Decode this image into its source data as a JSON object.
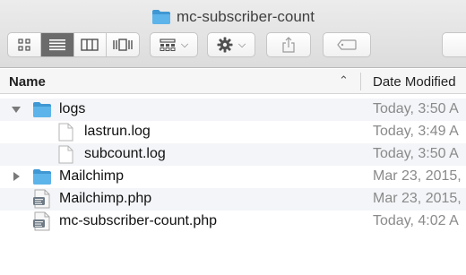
{
  "window": {
    "title": "mc-subscriber-count"
  },
  "toolbar": {
    "view_modes": [
      "icon-view",
      "list-view",
      "column-view",
      "cover-flow-view"
    ],
    "active_view": "list-view",
    "arrange_icon": "arrange-icon",
    "action_icon": "gear-icon",
    "share_icon": "share-icon",
    "tag_icon": "tag-icon"
  },
  "columns": {
    "name": "Name",
    "date_modified": "Date Modified"
  },
  "files": [
    {
      "name": "logs",
      "date": "Today, 3:50 A",
      "type": "folder",
      "expanded": true,
      "level": 0
    },
    {
      "name": "lastrun.log",
      "date": "Today, 3:49 A",
      "type": "document",
      "level": 1
    },
    {
      "name": "subcount.log",
      "date": "Today, 3:50 A",
      "type": "document",
      "level": 1
    },
    {
      "name": "Mailchimp",
      "date": "Mar 23, 2015,",
      "type": "folder",
      "expanded": false,
      "level": 0
    },
    {
      "name": "Mailchimp.php",
      "date": "Mar 23, 2015,",
      "type": "php",
      "level": 0
    },
    {
      "name": "mc-subscriber-count.php",
      "date": "Today, 4:02 A",
      "type": "php",
      "level": 0
    }
  ],
  "colors": {
    "folder": "#5db4ea",
    "folder_dark": "#3f98d3",
    "stripe": "#f3f5f8",
    "date_text": "#8a8a8a"
  }
}
